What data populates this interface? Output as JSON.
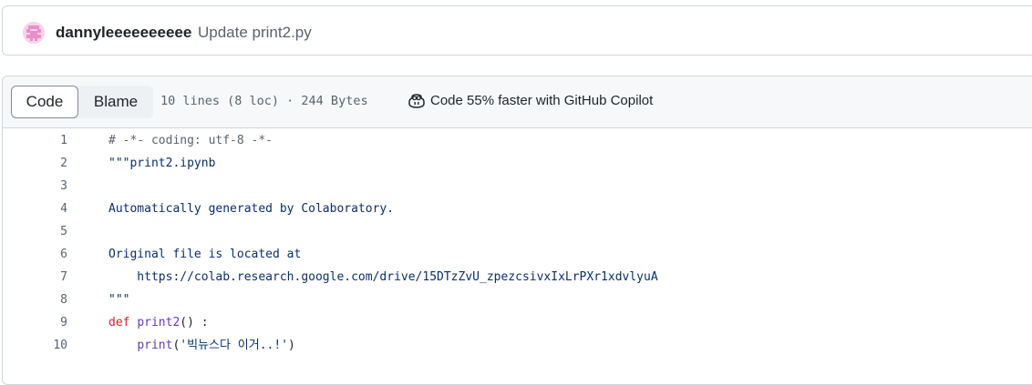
{
  "commit": {
    "author": "dannyleeeeeeeeee",
    "message": "Update print2.py"
  },
  "file_header": {
    "tabs": [
      "Code",
      "Blame"
    ],
    "active_tab": "Code",
    "file_info": "10 lines (8 loc) · 244 Bytes",
    "copilot_text": "Code 55% faster with GitHub Copilot"
  },
  "code": {
    "lines": [
      {
        "num": "1",
        "parts": [
          {
            "t": "# -*- coding: utf-8 -*-",
            "c": "comment"
          }
        ]
      },
      {
        "num": "2",
        "parts": [
          {
            "t": "\"\"\"print2.ipynb",
            "c": "string"
          }
        ]
      },
      {
        "num": "3",
        "parts": []
      },
      {
        "num": "4",
        "parts": [
          {
            "t": "Automatically generated by Colaboratory.",
            "c": "string"
          }
        ]
      },
      {
        "num": "5",
        "parts": []
      },
      {
        "num": "6",
        "parts": [
          {
            "t": "Original file is located at",
            "c": "string"
          }
        ]
      },
      {
        "num": "7",
        "parts": [
          {
            "t": "    https://colab.research.google.com/drive/15DTzZvU_zpezcsivxIxLrPXr1xdvlyuA",
            "c": "string"
          }
        ]
      },
      {
        "num": "8",
        "parts": [
          {
            "t": "\"\"\"",
            "c": "string"
          }
        ]
      },
      {
        "num": "9",
        "parts": [
          {
            "t": "def",
            "c": "keyword"
          },
          {
            "t": " ",
            "c": "plain"
          },
          {
            "t": "print2",
            "c": "func"
          },
          {
            "t": "() :",
            "c": "plain"
          }
        ]
      },
      {
        "num": "10",
        "parts": [
          {
            "t": "    ",
            "c": "plain"
          },
          {
            "t": "print",
            "c": "func"
          },
          {
            "t": "(",
            "c": "plain"
          },
          {
            "t": "'빅뉴스다 이거..!'",
            "c": "string"
          },
          {
            "t": ")",
            "c": "plain"
          }
        ]
      }
    ]
  },
  "colors": {
    "border": "#d0d7de",
    "header_bg": "#f6f8fa",
    "muted": "#59636e",
    "keyword": "#cf222e",
    "function": "#6639ba",
    "string": "#0a3069",
    "avatar": "#e88fc8"
  },
  "icons": {
    "avatar": "identicon-avatar",
    "copilot": "copilot-icon"
  }
}
